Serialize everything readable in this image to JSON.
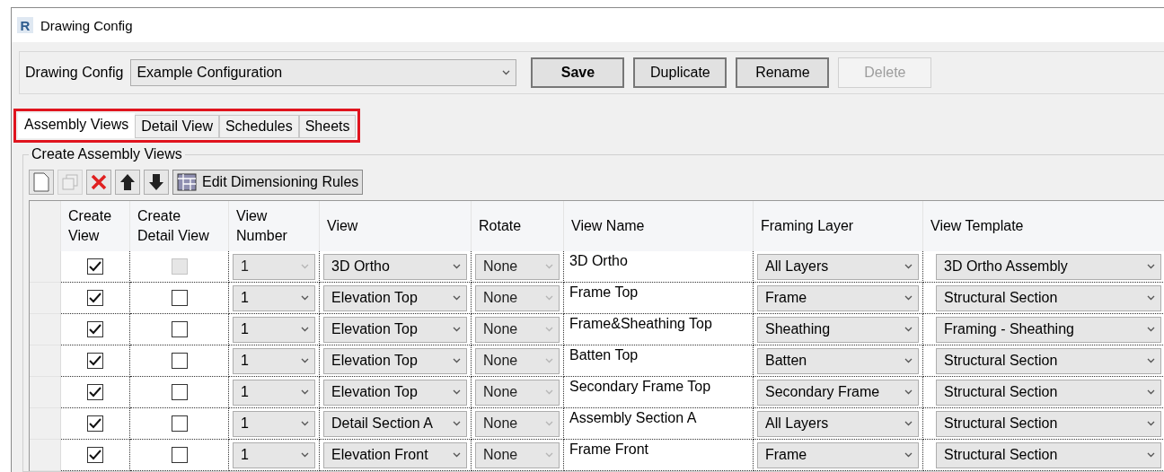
{
  "window": {
    "icon_letter": "R",
    "title": "Drawing Config"
  },
  "config": {
    "label": "Drawing Config",
    "value": "Example Configuration"
  },
  "buttons": [
    {
      "label": "Save",
      "kind": "default",
      "disabled": false
    },
    {
      "label": "Duplicate",
      "kind": "normal",
      "disabled": false
    },
    {
      "label": "Rename",
      "kind": "normal",
      "disabled": false
    },
    {
      "label": "Delete",
      "kind": "normal",
      "disabled": true
    }
  ],
  "tabs_highlighted": true,
  "tabs": [
    {
      "label": "Assembly Views",
      "selected": true
    },
    {
      "label": "Detail View",
      "selected": false
    },
    {
      "label": "Schedules",
      "selected": false
    },
    {
      "label": "Sheets",
      "selected": false
    }
  ],
  "group": {
    "title": "Create Assembly Views"
  },
  "toolbar": [
    {
      "kind": "new",
      "disabled": false
    },
    {
      "kind": "copy",
      "disabled": true
    },
    {
      "kind": "delete",
      "disabled": false
    },
    {
      "kind": "up",
      "disabled": false
    },
    {
      "kind": "down",
      "disabled": false
    },
    {
      "kind": "rules",
      "label": "Edit Dimensioning Rules",
      "disabled": false
    }
  ],
  "table": {
    "columns": [
      [
        "Create",
        "View"
      ],
      [
        "Create",
        "Detail View"
      ],
      [
        "View",
        "Number"
      ],
      [
        "View"
      ],
      [
        "Rotate"
      ],
      [
        "View Name"
      ],
      [
        "Framing Layer"
      ],
      [
        "View Template"
      ]
    ],
    "rows": [
      {
        "create_view": true,
        "create_detail_view": false,
        "detail_disabled": true,
        "view_number": "1",
        "view_number_disabled": true,
        "view": "3D Ortho",
        "rotate": "None",
        "rotate_disabled": true,
        "view_name": "3D Ortho",
        "framing_layer": "All Layers",
        "view_template": "3D Ortho Assembly"
      },
      {
        "create_view": true,
        "create_detail_view": false,
        "detail_disabled": false,
        "view_number": "1",
        "view_number_disabled": false,
        "view": "Elevation Top",
        "rotate": "None",
        "rotate_disabled": true,
        "view_name": "Frame Top",
        "framing_layer": "Frame",
        "view_template": "Structural Section"
      },
      {
        "create_view": true,
        "create_detail_view": false,
        "detail_disabled": false,
        "view_number": "1",
        "view_number_disabled": false,
        "view": "Elevation Top",
        "rotate": "None",
        "rotate_disabled": true,
        "view_name": "Frame&Sheathing Top",
        "framing_layer": "Sheathing",
        "view_template": "Framing -  Sheathing"
      },
      {
        "create_view": true,
        "create_detail_view": false,
        "detail_disabled": false,
        "view_number": "1",
        "view_number_disabled": false,
        "view": "Elevation Top",
        "rotate": "None",
        "rotate_disabled": true,
        "view_name": "Batten Top",
        "framing_layer": "Batten",
        "view_template": "Structural Section"
      },
      {
        "create_view": true,
        "create_detail_view": false,
        "detail_disabled": false,
        "view_number": "1",
        "view_number_disabled": false,
        "view": "Elevation Top",
        "rotate": "None",
        "rotate_disabled": true,
        "view_name": "Secondary Frame Top",
        "framing_layer": "Secondary Frame",
        "view_template": "Structural Section"
      },
      {
        "create_view": true,
        "create_detail_view": false,
        "detail_disabled": false,
        "view_number": "1",
        "view_number_disabled": false,
        "view": "Detail Section A",
        "rotate": "None",
        "rotate_disabled": true,
        "view_name": "Assembly Section A",
        "framing_layer": "All Layers",
        "view_template": "Structural Section"
      },
      {
        "create_view": true,
        "create_detail_view": false,
        "detail_disabled": false,
        "view_number": "1",
        "view_number_disabled": false,
        "view": "Elevation Front",
        "rotate": "None",
        "rotate_disabled": true,
        "view_name": "Frame Front",
        "framing_layer": "Frame",
        "view_template": "Structural Section"
      }
    ]
  }
}
